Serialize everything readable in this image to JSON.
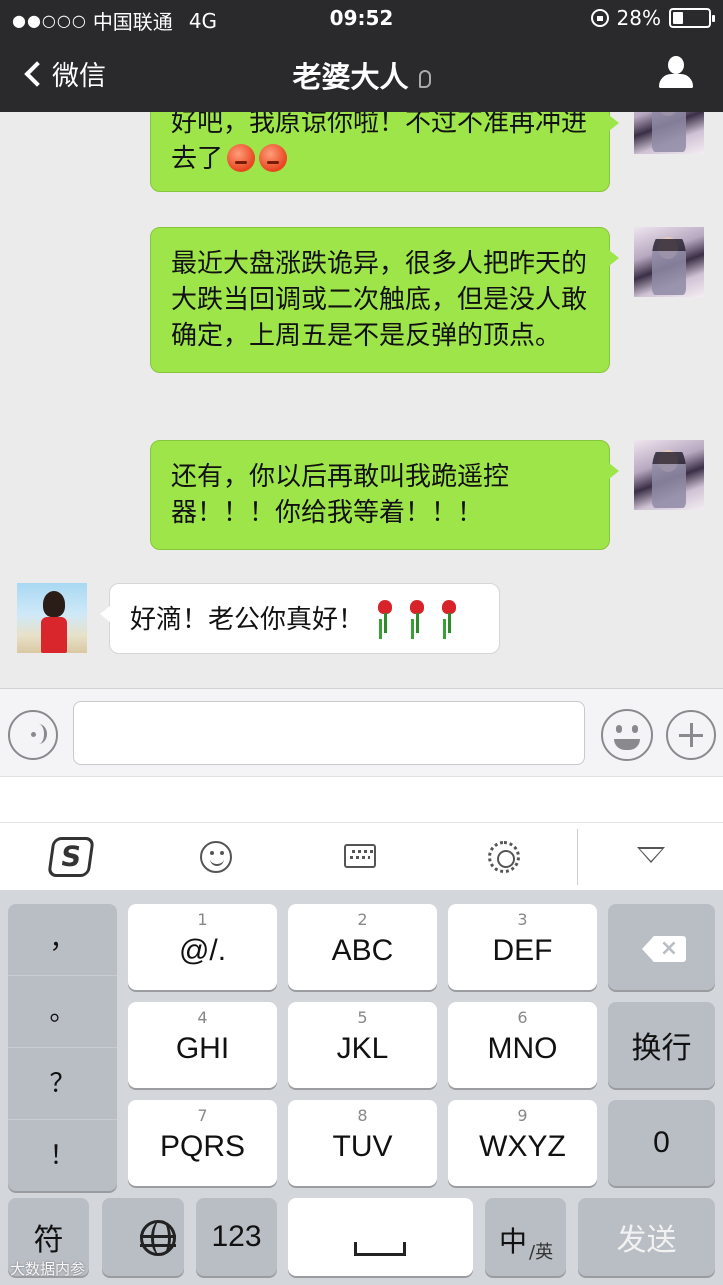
{
  "status_bar": {
    "signal": "●●○○○",
    "carrier": "中国联通",
    "network": "4G",
    "time": "09:52",
    "battery": "28%",
    "battery_level": 0.28
  },
  "nav": {
    "back_label": "微信",
    "title": "老婆大人"
  },
  "messages": [
    {
      "from": "me",
      "text": "好吧，我原谅你啦！不过不准再冲进去了",
      "emoji": [
        "angry-face",
        "angry-face"
      ]
    },
    {
      "from": "me",
      "text": "最近大盘涨跌诡异，很多人把昨天的大跌当回调或二次触底，但是没人敢确定，上周五是不是反弹的顶点。"
    },
    {
      "from": "me",
      "text": "还有，你以后再敢叫我跪遥控器！！！你给我等着！！！"
    },
    {
      "from": "her",
      "text": "好滴！老公你真好！",
      "emoji": [
        "rose",
        "rose",
        "rose"
      ]
    }
  ],
  "input": {
    "placeholder": ""
  },
  "keyboard": {
    "punct": [
      "，",
      "。",
      "？",
      "！"
    ],
    "rows": [
      [
        {
          "num": "1",
          "label": "@/."
        },
        {
          "num": "2",
          "label": "ABC"
        },
        {
          "num": "3",
          "label": "DEF"
        }
      ],
      [
        {
          "num": "4",
          "label": "GHI"
        },
        {
          "num": "5",
          "label": "JKL"
        },
        {
          "num": "6",
          "label": "MNO"
        }
      ],
      [
        {
          "num": "7",
          "label": "PQRS"
        },
        {
          "num": "8",
          "label": "TUV"
        },
        {
          "num": "9",
          "label": "WXYZ"
        }
      ]
    ],
    "enter_label": "换行",
    "zero_label": "0",
    "symbol_label": "符",
    "num_label": "123",
    "lang_main": "中",
    "lang_sub": "/英",
    "send_label": "发送"
  },
  "watermark": "大数据内参"
}
